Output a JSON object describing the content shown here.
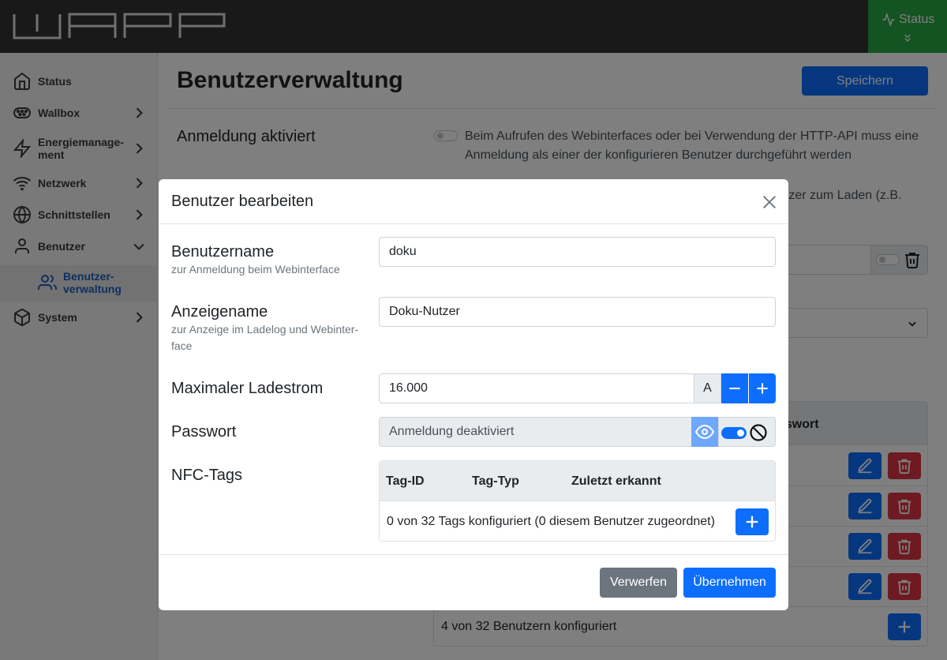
{
  "header": {
    "status_label": "Status"
  },
  "sidebar": {
    "items": [
      {
        "label": "Status",
        "icon": "home-icon"
      },
      {
        "label": "Wallbox",
        "icon": "wallbox-icon"
      },
      {
        "label": "Energiemanage-\nment",
        "icon": "lightning-icon"
      },
      {
        "label": "Netzwerk",
        "icon": "wifi-icon"
      },
      {
        "label": "Schnittstellen",
        "icon": "globe-icon"
      },
      {
        "label": "Benutzer",
        "icon": "user-icon"
      },
      {
        "label": "System",
        "icon": "box-icon"
      }
    ],
    "sub_item": {
      "label": "Benutzer-\nverwaltung",
      "icon": "users-icon"
    }
  },
  "main": {
    "title": "Benutzerverwaltung",
    "save_label": "Speichern",
    "login_label": "Anmeldung aktiviert",
    "login_desc": "Beim Aufrufen des Webinterfaces oder bei Verwendung der HTTP-API muss eine Anmeldung als einer der konfigurieren Benutzer durchgeführt werden",
    "partial_text_1": "utzer zum Laden (z.B.",
    "table_header_password": "sswort",
    "table_footer": "4 von 32 Benutzern konfiguriert"
  },
  "modal": {
    "title": "Benutzer bearbeiten",
    "username_label": "Benutzername",
    "username_help": "zur Anmeldung beim Webinterface",
    "username_value": "doku",
    "displayname_label": "Anzeigename",
    "displayname_help": "zur Anzeige im Ladelog und Webinter-\nface",
    "displayname_value": "Doku-Nutzer",
    "current_label": "Maximaler Ladestrom",
    "current_value": "16.000",
    "current_unit": "A",
    "password_label": "Passwort",
    "password_value": "Anmeldung deaktiviert",
    "nfc_label": "NFC-Tags",
    "nfc_columns": [
      "Tag-ID",
      "Tag-Typ",
      "Zuletzt erkannt"
    ],
    "nfc_footer": "0 von 32 Tags konfiguriert (0 diesem Benutzer zugeordnet)",
    "discard_label": "Verwerfen",
    "apply_label": "Übernehmen"
  },
  "colors": {
    "primary": "#0d6efd",
    "danger": "#dc3545",
    "secondary": "#6c757d",
    "status_ok": "#28a745",
    "header_bg": "#333333"
  }
}
